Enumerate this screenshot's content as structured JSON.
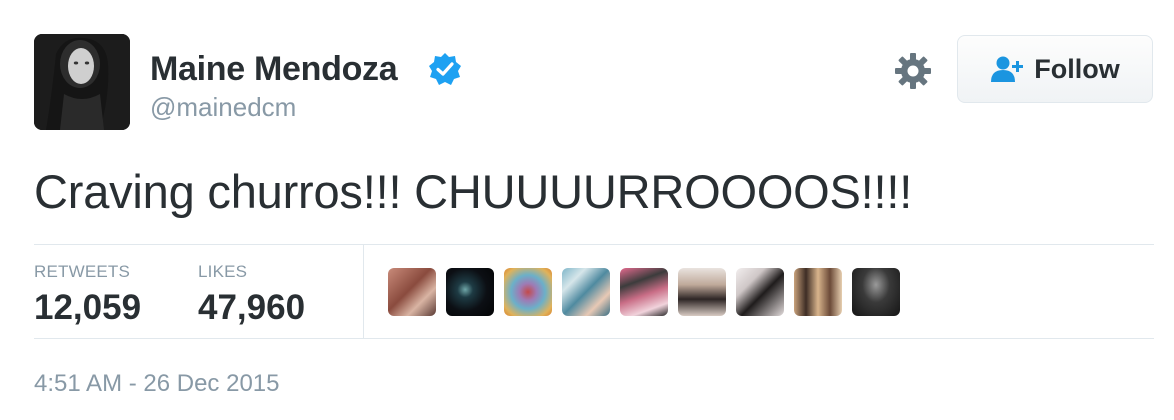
{
  "author": {
    "name": "Maine Mendoza",
    "handle": "@mainedcm",
    "verified": true,
    "verified_icon": "verified-badge-icon",
    "avatar_icon": "profile-photo"
  },
  "actions": {
    "settings_icon": "gear-icon",
    "follow_label": "Follow",
    "follow_icon": "add-user-icon"
  },
  "tweet": {
    "text": "Craving churros!!! CHUUUURROOOOS!!!!"
  },
  "stats": {
    "retweets_label": "RETWEETS",
    "retweets_value": "12,059",
    "likes_label": "LIKES",
    "likes_value": "47,960"
  },
  "likers": [
    {
      "icon": "liker-avatar"
    },
    {
      "icon": "liker-avatar"
    },
    {
      "icon": "liker-avatar"
    },
    {
      "icon": "liker-avatar"
    },
    {
      "icon": "liker-avatar"
    },
    {
      "icon": "liker-avatar"
    },
    {
      "icon": "liker-avatar"
    },
    {
      "icon": "liker-avatar"
    },
    {
      "icon": "liker-avatar"
    }
  ],
  "timestamp": "4:51 AM - 26 Dec 2015",
  "colors": {
    "verified_blue": "#1da1f2",
    "follow_icon_blue": "#1b95e0",
    "muted_text": "#8899a6",
    "primary_text": "#292f33",
    "divider": "#e1e8ed"
  }
}
